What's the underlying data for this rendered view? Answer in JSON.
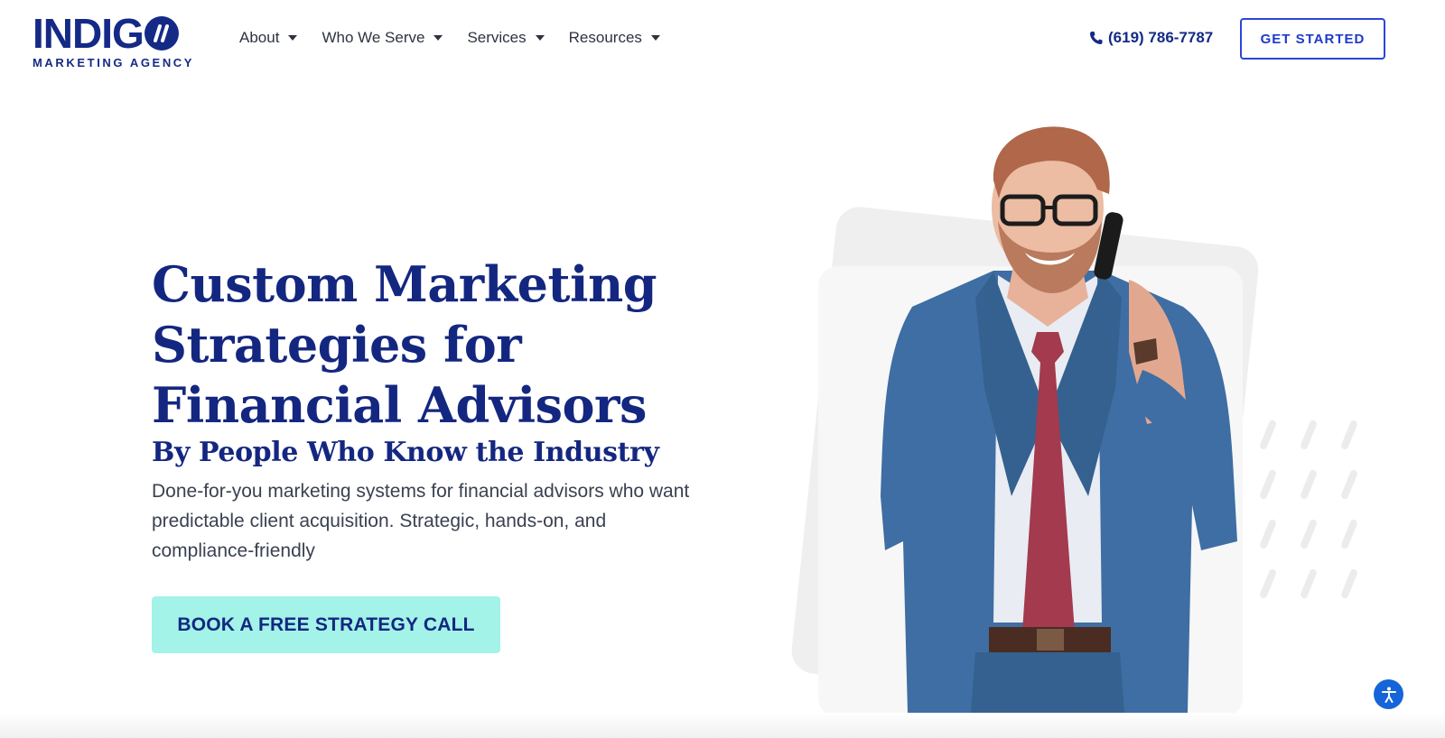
{
  "brand": {
    "logo_word": "INDIG",
    "logo_sub": "MARKETING AGENCY",
    "color_primary": "#152a86",
    "color_cta": "#a3f3e8",
    "color_button_border": "#2b46d6"
  },
  "nav": {
    "items": [
      {
        "label": "About",
        "icon": "caret-down-icon"
      },
      {
        "label": "Who We Serve",
        "icon": "caret-down-icon"
      },
      {
        "label": "Services",
        "icon": "caret-down-icon"
      },
      {
        "label": "Resources",
        "icon": "caret-down-icon"
      }
    ],
    "phone": "(619) 786-7787",
    "phone_icon": "phone-icon",
    "get_started": "GET STARTED"
  },
  "hero": {
    "title": "Custom Marketing Strategies for Financial Advisors",
    "subtitle": "By People Who Know the Industry",
    "description": "Done-for-you marketing systems for financial advisors who want predictable client acquisition. Strategic, hands-on, and compliance-friendly",
    "cta": "BOOK A FREE STRATEGY CALL",
    "image_subject": "businessman-on-phone-image"
  },
  "accessibility": {
    "icon": "accessibility-icon"
  }
}
